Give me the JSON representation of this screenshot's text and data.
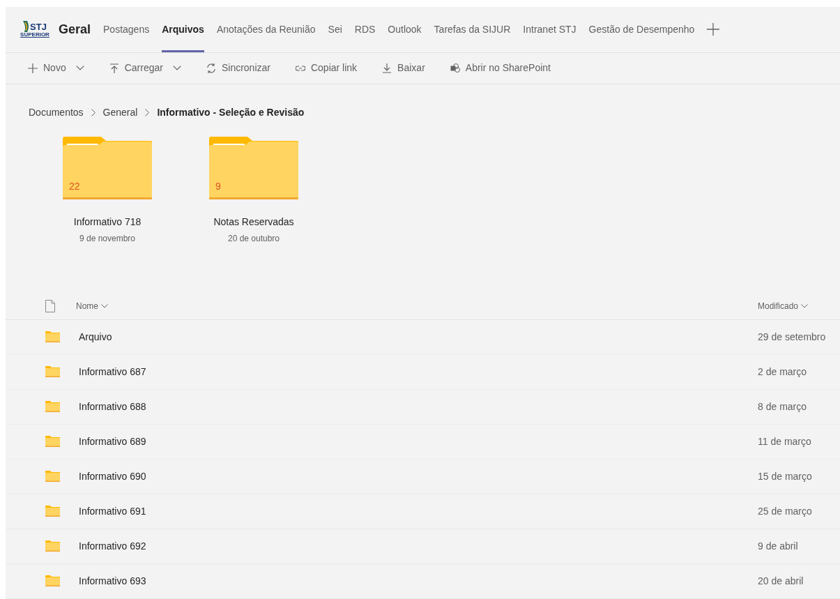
{
  "header": {
    "logo": {
      "mark": "STJ",
      "subtitle": "SUPERIOR"
    },
    "team": "Geral",
    "tabs": [
      {
        "label": "Postagens",
        "selected": false
      },
      {
        "label": "Arquivos",
        "selected": true
      },
      {
        "label": "Anotações da Reunião",
        "selected": false
      },
      {
        "label": "Sei",
        "selected": false
      },
      {
        "label": "RDS",
        "selected": false
      },
      {
        "label": "Outlook",
        "selected": false
      },
      {
        "label": "Tarefas da SIJUR",
        "selected": false
      },
      {
        "label": "Intranet STJ",
        "selected": false
      },
      {
        "label": "Gestão de Desempenho",
        "selected": false
      }
    ]
  },
  "toolbar": [
    {
      "kind": "plus",
      "label": "Novo",
      "dropdown": true
    },
    {
      "kind": "upload",
      "label": "Carregar",
      "dropdown": true
    },
    {
      "kind": "sync",
      "label": "Sincronizar",
      "dropdown": false
    },
    {
      "kind": "link",
      "label": "Copiar link",
      "dropdown": false
    },
    {
      "kind": "download",
      "label": "Baixar",
      "dropdown": false
    },
    {
      "kind": "sharepoint",
      "label": "Abrir no SharePoint",
      "dropdown": false
    }
  ],
  "breadcrumb": [
    "Documentos",
    "General",
    "Informativo - Seleção e Revisão"
  ],
  "tiles": [
    {
      "name": "Informativo 718",
      "date": "9 de novembro",
      "count": "22"
    },
    {
      "name": "Notas Reservadas",
      "date": "20 de outubro",
      "count": "9"
    }
  ],
  "table": {
    "columns": [
      "Nome",
      "Modificado"
    ],
    "rows": [
      {
        "name": "Arquivo",
        "modified": "29 de setembro"
      },
      {
        "name": "Informativo 687",
        "modified": "2 de março"
      },
      {
        "name": "Informativo 688",
        "modified": "8 de março"
      },
      {
        "name": "Informativo 689",
        "modified": "11 de março"
      },
      {
        "name": "Informativo 690",
        "modified": "15 de março"
      },
      {
        "name": "Informativo 691",
        "modified": "25 de março"
      },
      {
        "name": "Informativo 692",
        "modified": "9 de abril"
      },
      {
        "name": "Informativo 693",
        "modified": "20 de abril"
      }
    ]
  }
}
